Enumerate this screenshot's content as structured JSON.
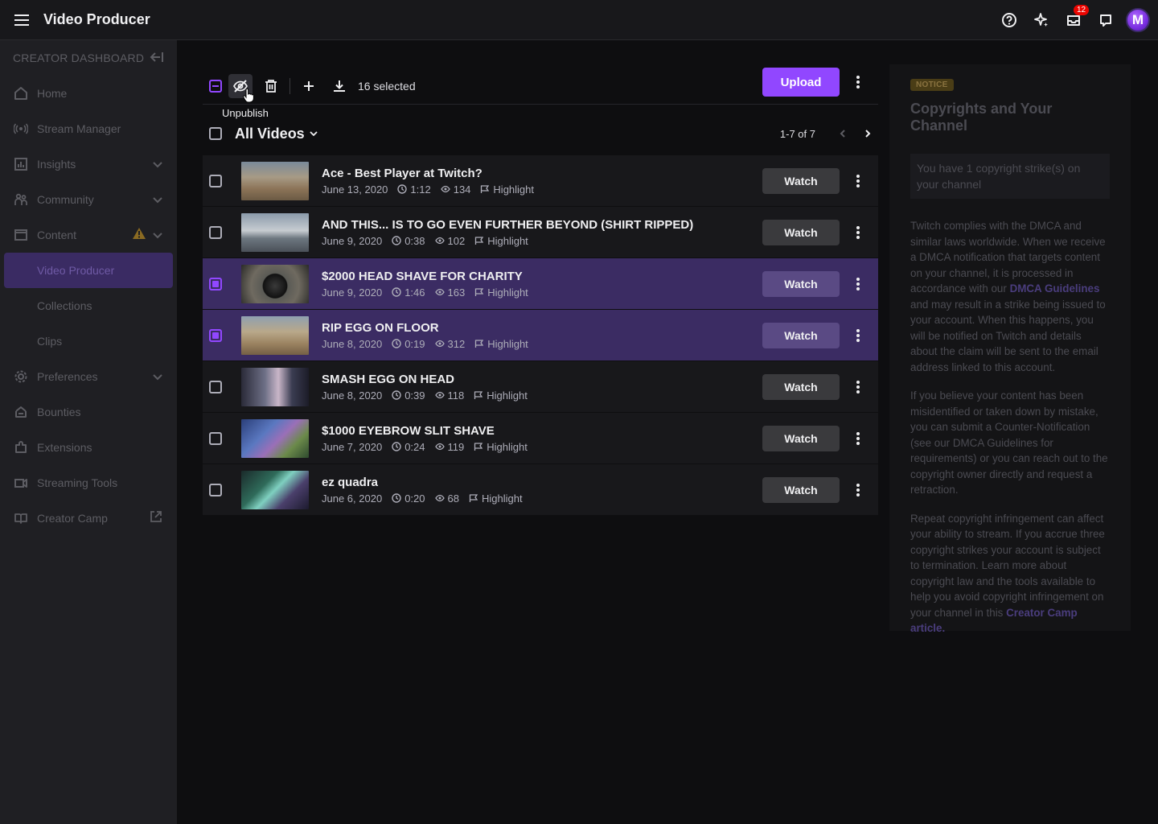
{
  "app": {
    "title": "Video Producer",
    "notification_count": "12",
    "avatar_letter": "M"
  },
  "sidebar": {
    "header": "CREATOR DASHBOARD",
    "items": [
      {
        "label": "Home",
        "icon": "home-icon"
      },
      {
        "label": "Stream Manager",
        "icon": "broadcast-icon"
      },
      {
        "label": "Insights",
        "icon": "chart-icon"
      },
      {
        "label": "Community",
        "icon": "community-icon"
      },
      {
        "label": "Content",
        "icon": "content-icon"
      },
      {
        "label": "Video Producer"
      },
      {
        "label": "Collections"
      },
      {
        "label": "Clips"
      },
      {
        "label": "Preferences",
        "icon": "gear-icon"
      },
      {
        "label": "Bounties",
        "icon": "bounties-icon"
      },
      {
        "label": "Extensions",
        "icon": "extensions-icon"
      },
      {
        "label": "Streaming Tools",
        "icon": "camera-icon"
      },
      {
        "label": "Creator Camp",
        "icon": "book-icon"
      }
    ]
  },
  "toolbar": {
    "selected_text": "16 selected",
    "upload_label": "Upload",
    "tooltip": "Unpublish"
  },
  "list": {
    "title": "All Videos",
    "pagination": "1-7 of 7"
  },
  "videos": [
    {
      "title": "Ace - Best Player at Twitch?",
      "date": "June 13, 2020",
      "duration": "1:12",
      "views": "134",
      "type": "Highlight",
      "selected": false,
      "watch": "Watch"
    },
    {
      "title": "AND THIS... IS TO GO EVEN FURTHER BEYOND (SHIRT RIPPED)",
      "date": "June 9, 2020",
      "duration": "0:38",
      "views": "102",
      "type": "Highlight",
      "selected": false,
      "watch": "Watch"
    },
    {
      "title": "$2000 HEAD SHAVE FOR CHARITY",
      "date": "June 9, 2020",
      "duration": "1:46",
      "views": "163",
      "type": "Highlight",
      "selected": true,
      "watch": "Watch"
    },
    {
      "title": "RIP EGG ON FLOOR",
      "date": "June 8, 2020",
      "duration": "0:19",
      "views": "312",
      "type": "Highlight",
      "selected": true,
      "watch": "Watch"
    },
    {
      "title": "SMASH EGG ON HEAD",
      "date": "June 8, 2020",
      "duration": "0:39",
      "views": "118",
      "type": "Highlight",
      "selected": false,
      "watch": "Watch"
    },
    {
      "title": "$1000 EYEBROW SLIT SHAVE",
      "date": "June 7, 2020",
      "duration": "0:24",
      "views": "119",
      "type": "Highlight",
      "selected": false,
      "watch": "Watch"
    },
    {
      "title": "ez quadra",
      "date": "June 6, 2020",
      "duration": "0:20",
      "views": "68",
      "type": "Highlight",
      "selected": false,
      "watch": "Watch"
    }
  ],
  "notice": {
    "tag": "NOTICE",
    "title": "Copyrights and Your Channel",
    "strike": "You have 1 copyright strike(s) on your channel",
    "p1_before": "Twitch complies with the DMCA and similar laws worldwide. When we receive a DMCA notification that targets content on your channel, it is processed in accordance with our ",
    "p1_link": "DMCA Guidelines",
    "p1_after": " and may result in a strike being issued to your account. When this happens, you will be notified on Twitch and details about the claim will be sent to the email address linked to this account.",
    "p2": "If you believe your content has been misidentified or taken down by mistake, you can submit a Counter-Notification (see our DMCA Guidelines for requirements) or you can reach out to the copyright owner directly and request a retraction.",
    "p3_before": "Repeat copyright infringement can affect your ability to stream. If you accrue three copyright strikes your account is subject to termination. Learn more about copyright law and the tools available to help you avoid copyright infringement on your channel in this ",
    "p3_link": "Creator Camp article",
    "p3_after": "."
  },
  "colors": {
    "accent": "#9147ff",
    "selected_row": "#3b2c63",
    "warning": "#f5a623"
  }
}
